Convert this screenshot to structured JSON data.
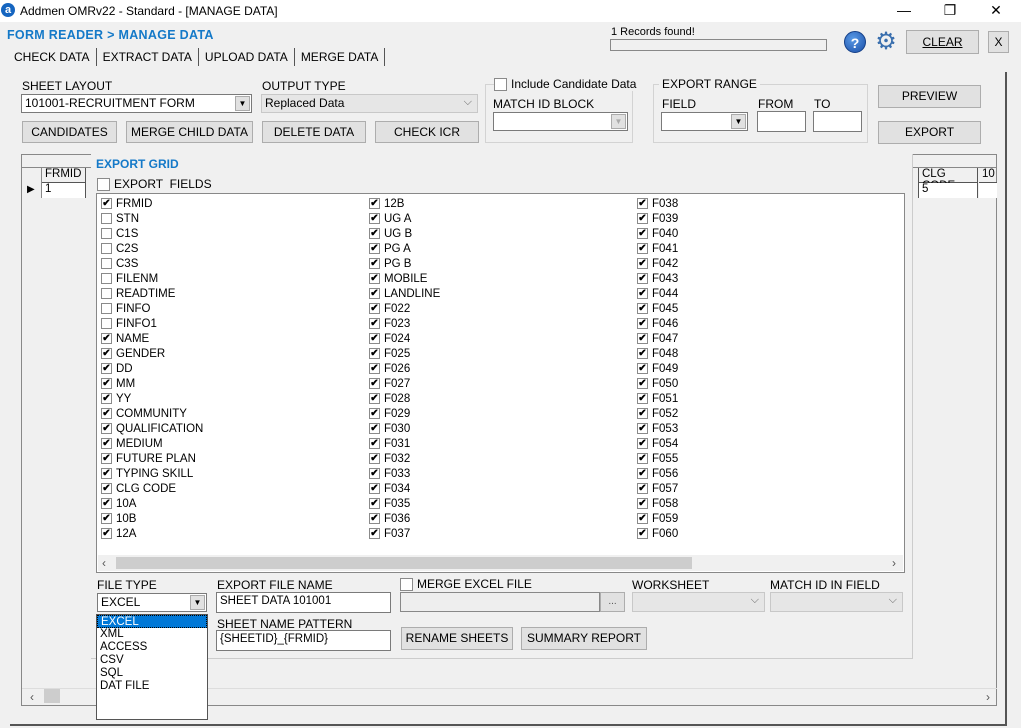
{
  "window": {
    "title": "Addmen OMRv22 - Standard - [MANAGE DATA]",
    "logo": "a",
    "minimize": "—",
    "restore": "❐",
    "close": "✕"
  },
  "breadcrumb": "FORM READER > MANAGE DATA",
  "tabs": [
    {
      "label": "CHECK DATA",
      "active": false
    },
    {
      "label": "EXTRACT DATA",
      "active": true
    },
    {
      "label": "UPLOAD DATA",
      "active": false
    },
    {
      "label": "MERGE DATA",
      "active": false
    }
  ],
  "status": {
    "records": "1 Records found!",
    "progress": 0
  },
  "header_buttons": {
    "help": "?",
    "settings": "⚙",
    "clear": "CLEAR",
    "close": "X"
  },
  "controls": {
    "sheet_layout_label": "SHEET LAYOUT",
    "sheet_layout_value": "101001-RECRUITMENT FORM",
    "output_type_label": "OUTPUT TYPE",
    "output_type_value": "Replaced Data",
    "include_candidate_label": "Include Candidate Data",
    "include_candidate_checked": false,
    "match_id_block_label": "MATCH ID BLOCK",
    "match_id_block_value": "",
    "export_range_label": "EXPORT RANGE",
    "field_label": "FIELD",
    "from_label": "FROM",
    "to_label": "TO",
    "field_value": "",
    "from_value": "",
    "to_value": "",
    "candidates_btn": "CANDIDATES",
    "merge_child_btn": "MERGE CHILD DATA",
    "delete_btn": "DELETE DATA",
    "check_icr_btn": "CHECK ICR",
    "preview_btn": "PREVIEW",
    "export_btn": "EXPORT"
  },
  "data_grid": {
    "columns": [
      "FRMID",
      "CLG CODE",
      "10"
    ],
    "rows": [
      {
        "FRMID": "1",
        "CLG CODE": "5"
      }
    ]
  },
  "export_grid": {
    "title": "EXPORT GRID",
    "export_fields_label": "EXPORT  FIELDS",
    "export_fields_checked": false,
    "columns": [
      [
        {
          "name": "FRMID",
          "checked": true
        },
        {
          "name": "STN",
          "checked": false
        },
        {
          "name": "C1S",
          "checked": false
        },
        {
          "name": "C2S",
          "checked": false
        },
        {
          "name": "C3S",
          "checked": false
        },
        {
          "name": "FILENM",
          "checked": false
        },
        {
          "name": "READTIME",
          "checked": false
        },
        {
          "name": "FINFO",
          "checked": false
        },
        {
          "name": "FINFO1",
          "checked": false
        },
        {
          "name": "NAME",
          "checked": true
        },
        {
          "name": "GENDER",
          "checked": true
        },
        {
          "name": "DD",
          "checked": true
        },
        {
          "name": "MM",
          "checked": true
        },
        {
          "name": "YY",
          "checked": true
        },
        {
          "name": "COMMUNITY",
          "checked": true
        },
        {
          "name": "QUALIFICATION",
          "checked": true
        },
        {
          "name": "MEDIUM",
          "checked": true
        },
        {
          "name": "FUTURE PLAN",
          "checked": true
        },
        {
          "name": "TYPING SKILL",
          "checked": true
        },
        {
          "name": "CLG CODE",
          "checked": true
        },
        {
          "name": "10A",
          "checked": true
        },
        {
          "name": "10B",
          "checked": true
        },
        {
          "name": "12A",
          "checked": true
        }
      ],
      [
        {
          "name": "12B",
          "checked": true
        },
        {
          "name": "UG A",
          "checked": true
        },
        {
          "name": "UG B",
          "checked": true
        },
        {
          "name": "PG A",
          "checked": true
        },
        {
          "name": "PG B",
          "checked": true
        },
        {
          "name": "MOBILE",
          "checked": true
        },
        {
          "name": "LANDLINE",
          "checked": true
        },
        {
          "name": "F022",
          "checked": true
        },
        {
          "name": "F023",
          "checked": true
        },
        {
          "name": "F024",
          "checked": true
        },
        {
          "name": "F025",
          "checked": true
        },
        {
          "name": "F026",
          "checked": true
        },
        {
          "name": "F027",
          "checked": true
        },
        {
          "name": "F028",
          "checked": true
        },
        {
          "name": "F029",
          "checked": true
        },
        {
          "name": "F030",
          "checked": true
        },
        {
          "name": "F031",
          "checked": true
        },
        {
          "name": "F032",
          "checked": true
        },
        {
          "name": "F033",
          "checked": true
        },
        {
          "name": "F034",
          "checked": true
        },
        {
          "name": "F035",
          "checked": true
        },
        {
          "name": "F036",
          "checked": true
        },
        {
          "name": "F037",
          "checked": true
        }
      ],
      [
        {
          "name": "F038",
          "checked": true
        },
        {
          "name": "F039",
          "checked": true
        },
        {
          "name": "F040",
          "checked": true
        },
        {
          "name": "F041",
          "checked": true
        },
        {
          "name": "F042",
          "checked": true
        },
        {
          "name": "F043",
          "checked": true
        },
        {
          "name": "F044",
          "checked": true
        },
        {
          "name": "F045",
          "checked": true
        },
        {
          "name": "F046",
          "checked": true
        },
        {
          "name": "F047",
          "checked": true
        },
        {
          "name": "F048",
          "checked": true
        },
        {
          "name": "F049",
          "checked": true
        },
        {
          "name": "F050",
          "checked": true
        },
        {
          "name": "F051",
          "checked": true
        },
        {
          "name": "F052",
          "checked": true
        },
        {
          "name": "F053",
          "checked": true
        },
        {
          "name": "F054",
          "checked": true
        },
        {
          "name": "F055",
          "checked": true
        },
        {
          "name": "F056",
          "checked": true
        },
        {
          "name": "F057",
          "checked": true
        },
        {
          "name": "F058",
          "checked": true
        },
        {
          "name": "F059",
          "checked": true
        },
        {
          "name": "F060",
          "checked": true
        }
      ]
    ],
    "file_type_label": "FILE TYPE",
    "file_type_value": "EXCEL",
    "file_type_options": [
      "EXCEL",
      "XML",
      "ACCESS",
      "CSV",
      "SQL",
      "DAT FILE"
    ],
    "file_type_selected": "EXCEL",
    "export_file_name_label": "EXPORT FILE NAME",
    "export_file_name_value": "SHEET DATA 101001",
    "merge_excel_label": "MERGE EXCEL FILE",
    "merge_excel_checked": false,
    "merge_excel_path": "",
    "browse_btn": "...",
    "worksheet_label": "WORKSHEET",
    "worksheet_value": "",
    "match_id_field_label": "MATCH ID IN FIELD",
    "match_id_field_value": "",
    "sheet_name_pattern_label": "SHEET NAME PATTERN",
    "sheet_name_pattern_value": "{SHEETID}_{FRMID}",
    "rename_sheets_btn": "RENAME SHEETS",
    "summary_report_btn": "SUMMARY REPORT"
  },
  "colors": {
    "accent": "#1479c8",
    "selection": "#0078d7"
  }
}
